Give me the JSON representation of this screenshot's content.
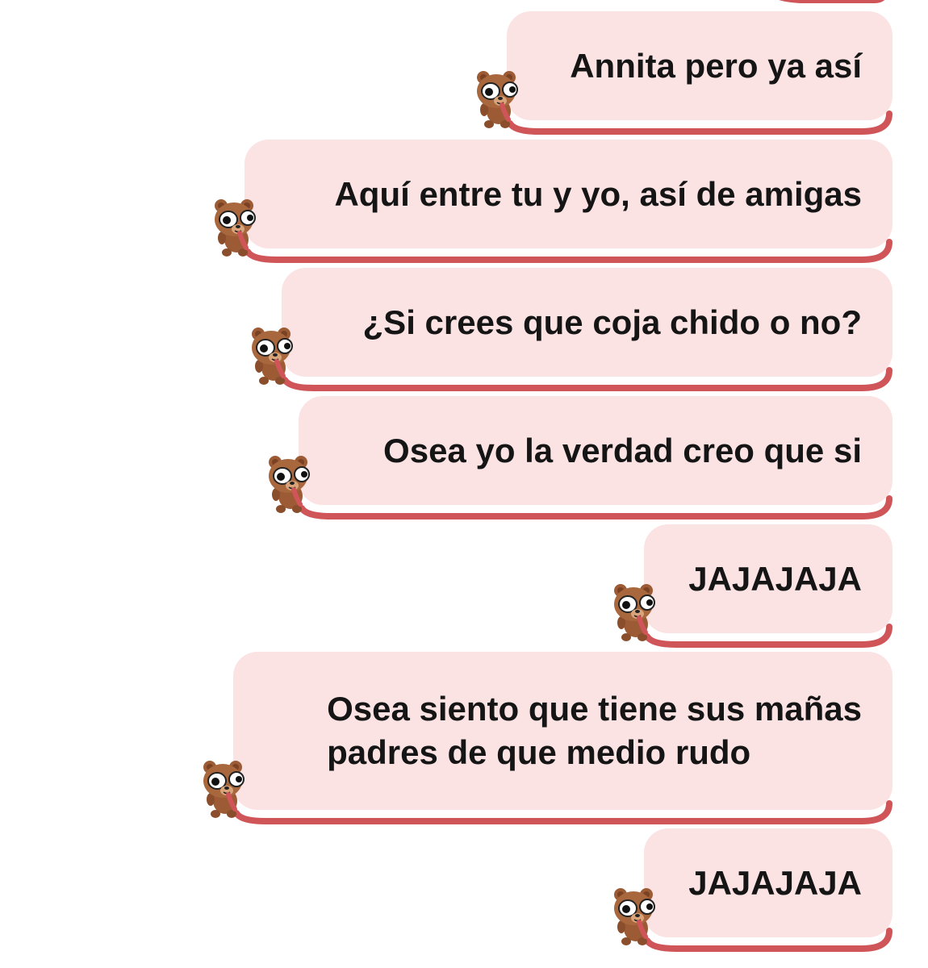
{
  "messages": [
    {
      "text": "Annita pero ya así",
      "sender": "self"
    },
    {
      "text": "Aquí entre tu y yo, así de amigas",
      "sender": "self"
    },
    {
      "text": "¿Si crees que coja chido o no?",
      "sender": "self"
    },
    {
      "text": "Osea yo la verdad creo que si",
      "sender": "self"
    },
    {
      "text": "JAJAJAJA",
      "sender": "self"
    },
    {
      "text": "Osea siento que tiene sus mañas\npadres de que medio rudo",
      "sender": "self"
    },
    {
      "text": "JAJAJAJA",
      "sender": "self"
    }
  ],
  "theme": {
    "bubble_color": "#fbe3e4",
    "accent_color": "#cf5559",
    "text_color": "#151515",
    "avatar_icon": "bear-sticker-icon"
  }
}
